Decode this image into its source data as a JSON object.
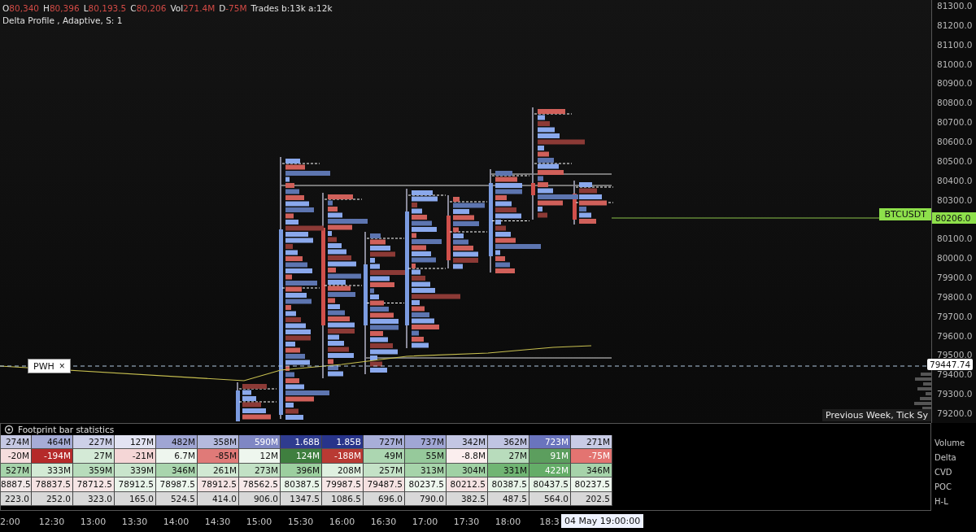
{
  "header": {
    "ohlc": [
      {
        "label": "O",
        "value": "80,340"
      },
      {
        "label": "H",
        "value": "80,396"
      },
      {
        "label": "L",
        "value": "80,193.5"
      },
      {
        "label": "C",
        "value": "80,206"
      },
      {
        "label": "Vol",
        "value": "271.4M"
      },
      {
        "label": "D",
        "value": "-75M"
      }
    ],
    "trades": "Trades b:13k a:12k",
    "indicator": "Delta Profile , Adaptive, S: 1"
  },
  "price_axis": {
    "ticks": [
      "81300.0",
      "81200.0",
      "81100.0",
      "81000.0",
      "80900.0",
      "80800.0",
      "80700.0",
      "80600.0",
      "80500.0",
      "80400.0",
      "80300.0",
      "80100.0",
      "80000.0",
      "79900.0",
      "79800.0",
      "79700.0",
      "79600.0",
      "79500.0",
      "79400.0",
      "79300.0",
      "79200.0"
    ],
    "last_price": "80206.0",
    "symbol": "BTCUSDT",
    "cursor_price": "79447.74"
  },
  "pwh_label": {
    "text": "PWH",
    "close": "×"
  },
  "legend": "Previous Week, Tick Sy",
  "stats": {
    "title": "Footprint bar statistics",
    "rows": [
      {
        "label": "Volume",
        "cells": [
          {
            "value": "274M",
            "color": "#c5c8e3"
          },
          {
            "value": "464M",
            "color": "#a6acd6"
          },
          {
            "value": "227M",
            "color": "#cdd0e8"
          },
          {
            "value": "127M",
            "color": "#e2e3f2"
          },
          {
            "value": "482M",
            "color": "#9fa5d3"
          },
          {
            "value": "358M",
            "color": "#b4b9dd"
          },
          {
            "value": "590M",
            "color": "#7f87c4"
          },
          {
            "value": "1.68B",
            "color": "#2f3c8f"
          },
          {
            "value": "1.85B",
            "color": "#28348a"
          },
          {
            "value": "727M",
            "color": "#a8aed8"
          },
          {
            "value": "737M",
            "color": "#a0a6d4"
          },
          {
            "value": "342M",
            "color": "#c3c6e3"
          },
          {
            "value": "362M",
            "color": "#c0c4e2"
          },
          {
            "value": "723M",
            "color": "#6a74bd"
          },
          {
            "value": "271M",
            "color": "#c8cbe5"
          }
        ]
      },
      {
        "label": "Delta",
        "cells": [
          {
            "value": "-20M",
            "color": "#f6dede"
          },
          {
            "value": "-194M",
            "color": "#b52a2a"
          },
          {
            "value": "27M",
            "color": "#d4ead6"
          },
          {
            "value": "-21M",
            "color": "#f5d6d6"
          },
          {
            "value": "6.7M",
            "color": "#eef6ee"
          },
          {
            "value": "-85M",
            "color": "#e07a78"
          },
          {
            "value": "12M",
            "color": "#eef6ee"
          },
          {
            "value": "124M",
            "color": "#3f7f3f"
          },
          {
            "value": "-188M",
            "color": "#b93a33"
          },
          {
            "value": "49M",
            "color": "#acd6b1"
          },
          {
            "value": "55M",
            "color": "#96c99b"
          },
          {
            "value": "-8.8M",
            "color": "#fbeeee"
          },
          {
            "value": "27M",
            "color": "#b8dcbc"
          },
          {
            "value": "91M",
            "color": "#5c9e5e"
          },
          {
            "value": "-75M",
            "color": "#e37471"
          }
        ]
      },
      {
        "label": "CVD",
        "cells": [
          {
            "value": "527M",
            "color": "#a6d3aa"
          },
          {
            "value": "333M",
            "color": "#d3ead5"
          },
          {
            "value": "359M",
            "color": "#b7dcbb"
          },
          {
            "value": "339M",
            "color": "#c9e5cc"
          },
          {
            "value": "346M",
            "color": "#a9d5ad"
          },
          {
            "value": "261M",
            "color": "#d1e9d3"
          },
          {
            "value": "273M",
            "color": "#c2e1c5"
          },
          {
            "value": "396M",
            "color": "#9ccf9f"
          },
          {
            "value": "208M",
            "color": "#dff0e0"
          },
          {
            "value": "257M",
            "color": "#c4e2c7"
          },
          {
            "value": "313M",
            "color": "#a6d4aa"
          },
          {
            "value": "304M",
            "color": "#a0d1a4"
          },
          {
            "value": "331M",
            "color": "#70b573"
          },
          {
            "value": "422M",
            "color": "#64ad68"
          },
          {
            "value": "346M",
            "color": "#a6d3aa"
          }
        ]
      },
      {
        "label": "POC",
        "cells": [
          {
            "value": "8887.5",
            "color": "#f2e8e8"
          },
          {
            "value": "78837.5",
            "color": "#f4e2e2"
          },
          {
            "value": "78712.5",
            "color": "#f7e6e6"
          },
          {
            "value": "78912.5",
            "color": "#e9f4ea"
          },
          {
            "value": "78987.5",
            "color": "#eef7ee"
          },
          {
            "value": "78912.5",
            "color": "#f5e4e4"
          },
          {
            "value": "78562.5",
            "color": "#f8e9e9"
          },
          {
            "value": "80387.5",
            "color": "#e8f4e9"
          },
          {
            "value": "79987.5",
            "color": "#f7e6e6"
          },
          {
            "value": "79487.5",
            "color": "#f5e1e1"
          },
          {
            "value": "80237.5",
            "color": "#eef7ee"
          },
          {
            "value": "80212.5",
            "color": "#f6e4e4"
          },
          {
            "value": "80387.5",
            "color": "#e8f4e9"
          },
          {
            "value": "80437.5",
            "color": "#e6f3e7"
          },
          {
            "value": "80237.5",
            "color": "#eef7ee"
          }
        ]
      },
      {
        "label": "H-L",
        "cells": [
          {
            "value": "223.0",
            "color": "#d8d8d8"
          },
          {
            "value": "252.0",
            "color": "#d8d8d8"
          },
          {
            "value": "323.0",
            "color": "#d8d8d8"
          },
          {
            "value": "165.0",
            "color": "#d8d8d8"
          },
          {
            "value": "524.5",
            "color": "#d8d8d8"
          },
          {
            "value": "414.0",
            "color": "#d8d8d8"
          },
          {
            "value": "906.0",
            "color": "#d8d8d8"
          },
          {
            "value": "1347.5",
            "color": "#d8d8d8"
          },
          {
            "value": "1086.5",
            "color": "#d8d8d8"
          },
          {
            "value": "696.0",
            "color": "#d8d8d8"
          },
          {
            "value": "790.0",
            "color": "#d8d8d8"
          },
          {
            "value": "382.5",
            "color": "#d8d8d8"
          },
          {
            "value": "487.5",
            "color": "#d8d8d8"
          },
          {
            "value": "564.0",
            "color": "#d8d8d8"
          },
          {
            "value": "202.5",
            "color": "#d8d8d8"
          }
        ]
      }
    ]
  },
  "time_axis": {
    "labels": [
      "2:00",
      "12:30",
      "13:00",
      "13:30",
      "14:00",
      "14:30",
      "15:00",
      "15:30",
      "16:00",
      "16:30",
      "17:00",
      "17:30",
      "18:00",
      "18:3"
    ],
    "cursor_time": "04 May 19:00:00"
  }
}
